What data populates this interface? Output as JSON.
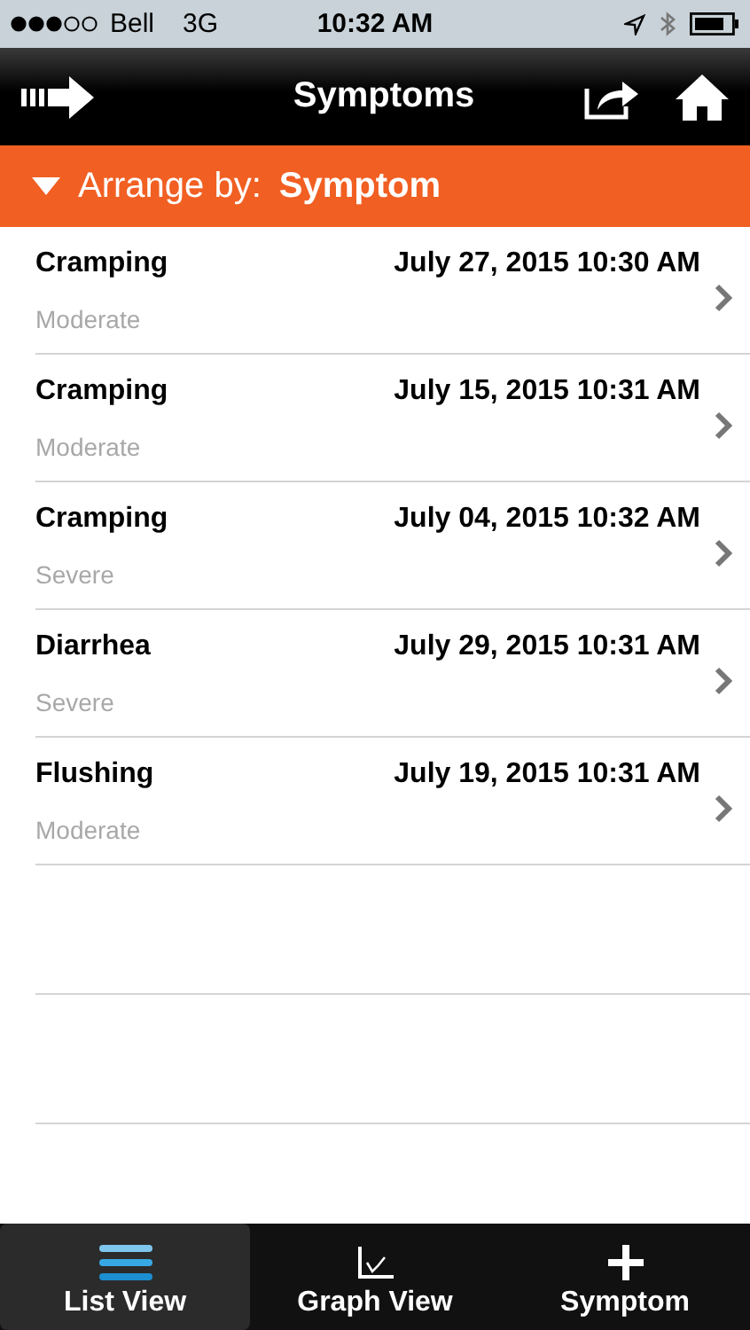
{
  "status_bar": {
    "carrier": "Bell",
    "network": "3G",
    "time": "10:32 AM"
  },
  "nav_bar": {
    "title": "Symptoms"
  },
  "arrange_bar": {
    "label": "Arrange by:",
    "value": "Symptom",
    "expanded": true
  },
  "entries": [
    {
      "symptom": "Cramping",
      "date": "July 27, 2015 10:30 AM",
      "severity": "Moderate"
    },
    {
      "symptom": "Cramping",
      "date": "July 15, 2015 10:31 AM",
      "severity": "Moderate"
    },
    {
      "symptom": "Cramping",
      "date": "July 04, 2015 10:32 AM",
      "severity": "Severe"
    },
    {
      "symptom": "Diarrhea",
      "date": "July 29, 2015 10:31 AM",
      "severity": "Severe"
    },
    {
      "symptom": "Flushing",
      "date": "July 19, 2015 10:31 AM",
      "severity": "Moderate"
    }
  ],
  "tab_bar": [
    {
      "label": "List View",
      "kind": "list",
      "selected": true
    },
    {
      "label": "Graph View",
      "kind": "graph",
      "selected": false
    },
    {
      "label": "Symptom",
      "kind": "add",
      "selected": false
    }
  ]
}
